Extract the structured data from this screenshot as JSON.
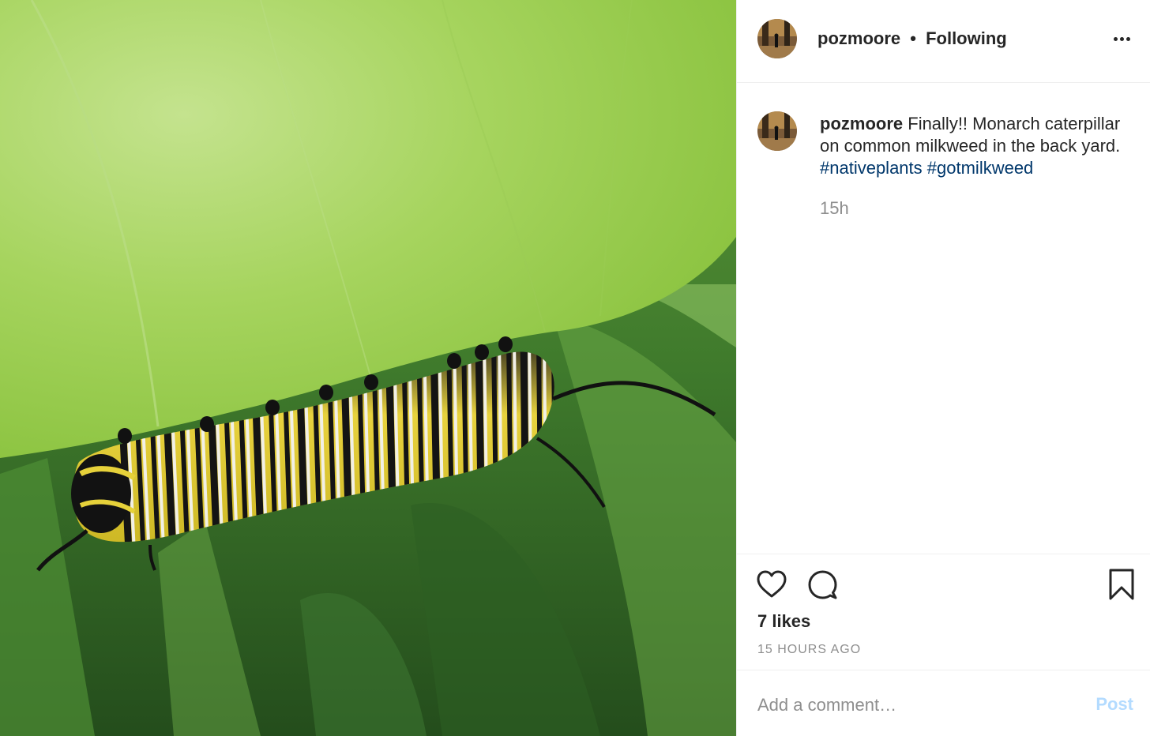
{
  "header": {
    "username": "pozmoore",
    "separator": "•",
    "follow_status": "Following"
  },
  "caption": {
    "username": "pozmoore",
    "text": "Finally!! Monarch caterpillar on common milkweed in the back yard.",
    "hashtags": [
      "#nativeplants",
      "#gotmilkweed"
    ],
    "relative_time": "15h"
  },
  "actions": {
    "likes": "7 likes",
    "timestamp": "15 HOURS AGO"
  },
  "comment": {
    "placeholder": "Add a comment…",
    "post_label": "Post"
  },
  "icons": {
    "more": "more-options-icon",
    "like": "heart-icon",
    "comment": "comment-bubble-icon",
    "save": "bookmark-icon"
  },
  "colors": {
    "hashtag": "#00376b",
    "post_button_disabled": "#b3dbff",
    "muted_text": "#8e8e8e",
    "divider": "#efefef"
  }
}
